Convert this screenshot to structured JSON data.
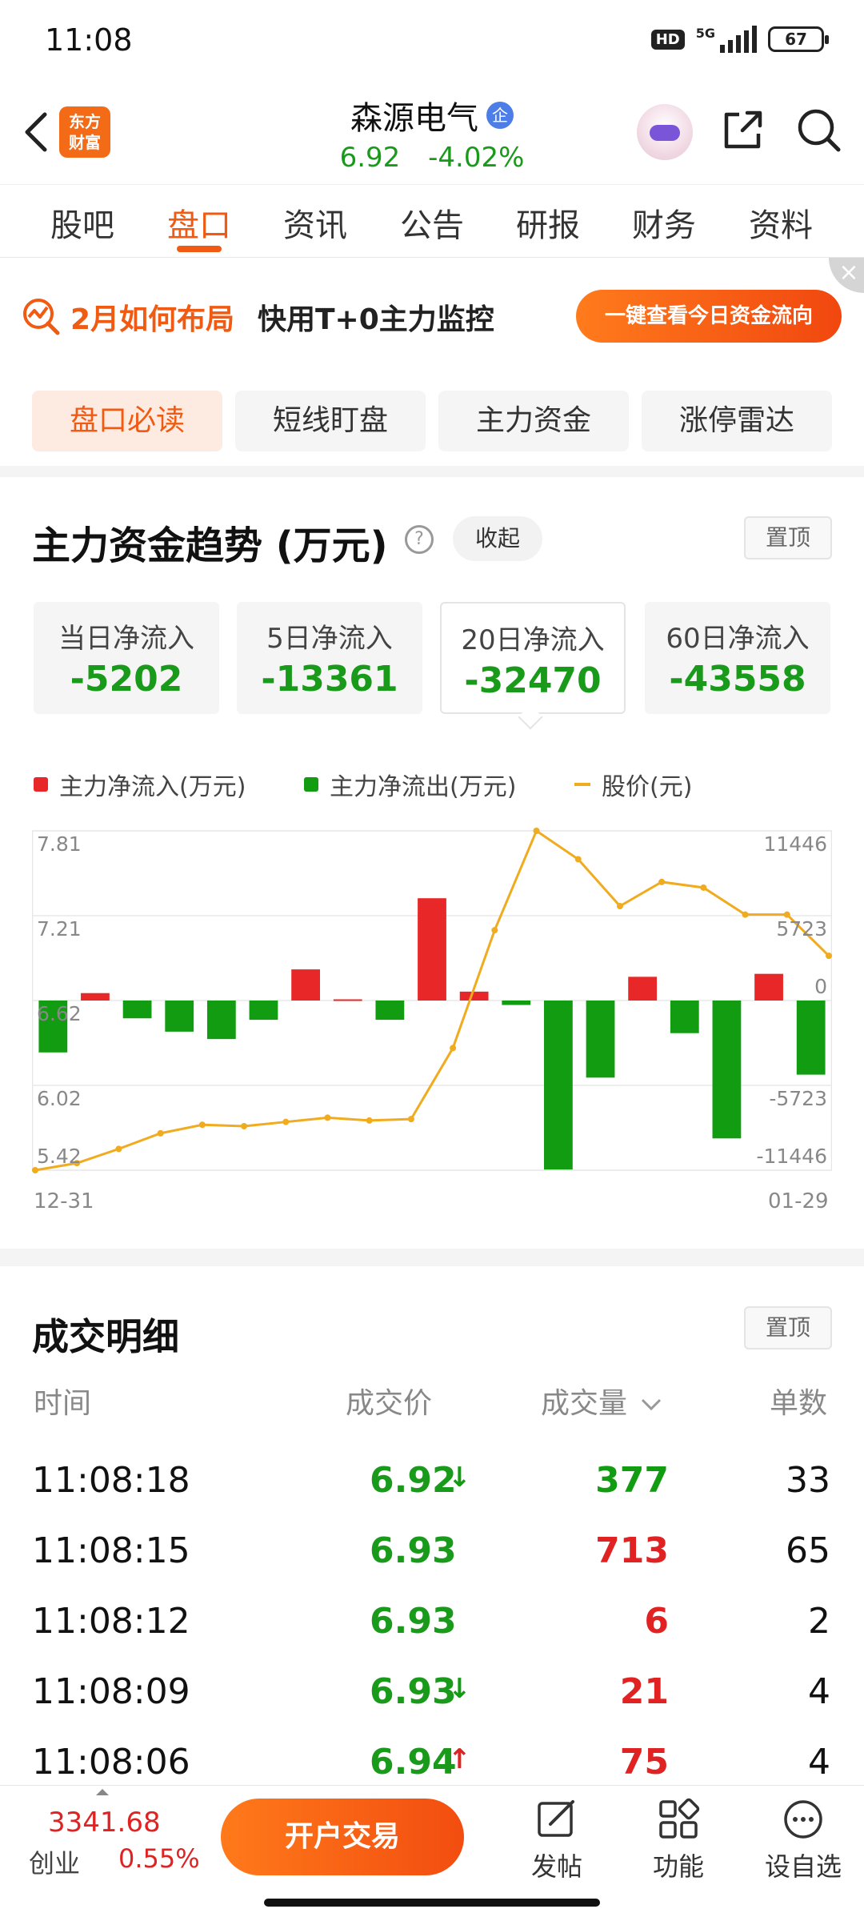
{
  "status": {
    "time": "11:08",
    "hd": "HD",
    "network": "5G",
    "battery": "67"
  },
  "header": {
    "logo_line1": "东方",
    "logo_line2": "财富",
    "stock_name": "森源电气",
    "badge": "企",
    "price": "6.92",
    "change_pct": "-4.02%"
  },
  "tabs": [
    {
      "label": "股吧"
    },
    {
      "label": "盘口"
    },
    {
      "label": "资讯"
    },
    {
      "label": "公告"
    },
    {
      "label": "研报"
    },
    {
      "label": "财务"
    },
    {
      "label": "资料"
    }
  ],
  "banner": {
    "highlight": "2月如何布局",
    "text": "快用T+0主力监控",
    "button": "一键查看今日资金流向",
    "close": "×"
  },
  "segments": [
    {
      "label": "盘口必读"
    },
    {
      "label": "短线盯盘"
    },
    {
      "label": "主力资金"
    },
    {
      "label": "涨停雷达"
    }
  ],
  "fund_trend": {
    "title": "主力资金趋势 (万元)",
    "help": "?",
    "collapse": "收起",
    "pin": "置顶",
    "cards": [
      {
        "label": "当日净流入",
        "value": "-5202"
      },
      {
        "label": "5日净流入",
        "value": "-13361"
      },
      {
        "label": "20日净流入",
        "value": "-32470"
      },
      {
        "label": "60日净流入",
        "value": "-43558"
      }
    ],
    "legend": {
      "inflow": "主力净流入(万元)",
      "outflow": "主力净流出(万元)",
      "price": "股价(元)"
    },
    "colors": {
      "inflow": "#e82828",
      "outflow": "#119c11",
      "price": "#f0ab1e"
    }
  },
  "chart_data": {
    "type": "bar",
    "y_left_ticks": [
      "7.81",
      "7.21",
      "6.62",
      "6.02",
      "5.42"
    ],
    "y_right_ticks": [
      "11446",
      "5723",
      "0",
      "-5723",
      "-11446"
    ],
    "x_start": "12-31",
    "x_end": "01-29",
    "ylim_left": [
      5.42,
      7.81
    ],
    "ylim_right": [
      -11446,
      11446
    ],
    "series": [
      {
        "name": "主力净流入(万元)/主力净流出(万元)",
        "values": [
          -3500,
          500,
          -1200,
          -2100,
          -2600,
          -1300,
          2100,
          80,
          -1300,
          6900,
          600,
          -300,
          -11400,
          -5200,
          1600,
          -2200,
          -9300,
          1800,
          -5000
        ]
      },
      {
        "name": "股价(元)",
        "values": [
          5.42,
          5.47,
          5.57,
          5.68,
          5.74,
          5.73,
          5.76,
          5.79,
          5.77,
          5.78,
          6.28,
          7.11,
          7.81,
          7.61,
          7.28,
          7.45,
          7.41,
          7.22,
          7.22,
          6.93
        ]
      }
    ]
  },
  "trades": {
    "title": "成交明细",
    "pin": "置顶",
    "headers": {
      "time": "时间",
      "price": "成交价",
      "volume": "成交量",
      "count": "单数"
    },
    "rows": [
      {
        "time": "11:08:18",
        "price": "6.92",
        "arrow": "↓",
        "volume": "377",
        "vol_color": "#119c11",
        "count": "33"
      },
      {
        "time": "11:08:15",
        "price": "6.93",
        "arrow": "",
        "volume": "713",
        "vol_color": "#e02222",
        "count": "65"
      },
      {
        "time": "11:08:12",
        "price": "6.93",
        "arrow": "",
        "volume": "6",
        "vol_color": "#e02222",
        "count": "2"
      },
      {
        "time": "11:08:09",
        "price": "6.93",
        "arrow": "↓",
        "volume": "21",
        "vol_color": "#e02222",
        "count": "4"
      },
      {
        "time": "11:08:06",
        "price": "6.94",
        "arrow": "↑",
        "volume": "75",
        "vol_color": "#e02222",
        "count": "4"
      }
    ]
  },
  "bottom": {
    "index_value": "3341.68",
    "index_name": "创业",
    "index_change": "0.55%",
    "trade_button": "开户交易",
    "post": "发帖",
    "functions": "功能",
    "watchlist": "设自选"
  }
}
